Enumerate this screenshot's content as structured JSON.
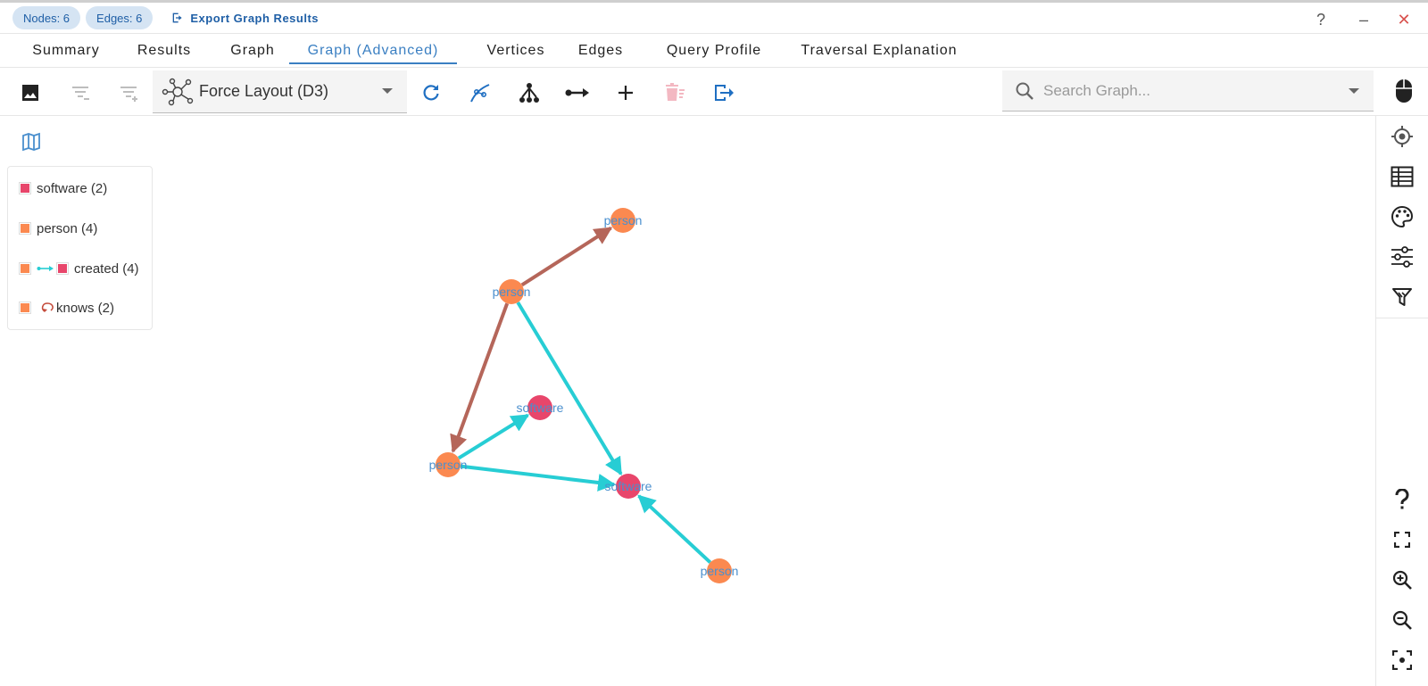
{
  "header": {
    "nodes_chip": "Nodes: 6",
    "edges_chip": "Edges: 6",
    "export_label": "Export Graph Results",
    "help_label": "?",
    "minimize_label": "–",
    "close_label": "✕"
  },
  "tabs": [
    {
      "label": "Summary"
    },
    {
      "label": "Results"
    },
    {
      "label": "Graph"
    },
    {
      "label": "Graph (Advanced)",
      "active": true
    },
    {
      "label": "Vertices"
    },
    {
      "label": "Edges"
    },
    {
      "label": "Query Profile"
    },
    {
      "label": "Traversal Explanation"
    }
  ],
  "toolbar": {
    "layout_value": "Force Layout (D3)",
    "search_placeholder": "Search Graph..."
  },
  "legend": {
    "items": [
      {
        "label": "software (2)",
        "kind": "vertex",
        "color": "#e8466b"
      },
      {
        "label": "person (4)",
        "kind": "vertex",
        "color": "#fb8950"
      },
      {
        "label": "created (4)",
        "kind": "edge",
        "color": "#27cdd4",
        "from_color": "#fb8950",
        "to_color": "#e8466b"
      },
      {
        "label": "knows (2)",
        "kind": "self-edge",
        "color": "#b5665a",
        "from_color": "#fb8950"
      }
    ]
  },
  "graph": {
    "nodes": [
      {
        "id": "n1",
        "label": "person",
        "type": "person"
      },
      {
        "id": "n2",
        "label": "person",
        "type": "person"
      },
      {
        "id": "n3",
        "label": "software",
        "type": "software"
      },
      {
        "id": "n4",
        "label": "person",
        "type": "person"
      },
      {
        "id": "n5",
        "label": "software",
        "type": "software"
      },
      {
        "id": "n6",
        "label": "person",
        "type": "person"
      }
    ],
    "edges": [
      {
        "from": "n2",
        "to": "n1",
        "label": "knows"
      },
      {
        "from": "n2",
        "to": "n4",
        "label": "knows"
      },
      {
        "from": "n2",
        "to": "n5",
        "label": "created"
      },
      {
        "from": "n4",
        "to": "n3",
        "label": "created"
      },
      {
        "from": "n4",
        "to": "n5",
        "label": "created"
      },
      {
        "from": "n6",
        "to": "n5",
        "label": "created"
      }
    ],
    "colors": {
      "person": "#fb8950",
      "software": "#e8466b",
      "knows": "#b5665a",
      "created": "#27cdd4"
    }
  }
}
